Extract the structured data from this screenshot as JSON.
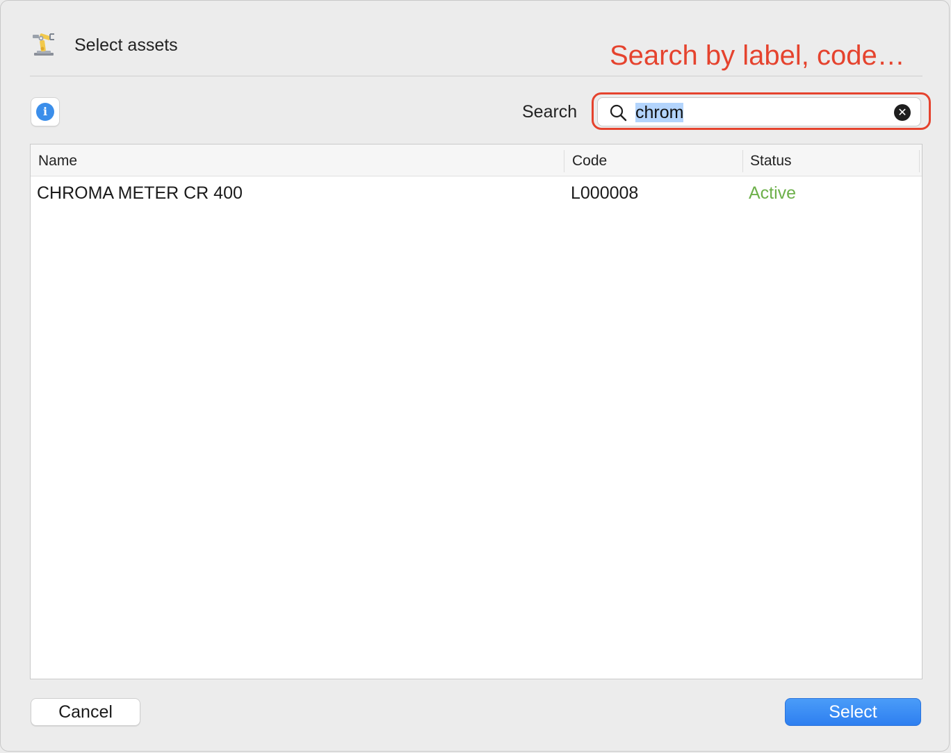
{
  "dialog": {
    "title": "Select assets",
    "app_icon": "robot-arm-icon"
  },
  "annotation": {
    "text": "Search by label, code…",
    "color": "#e5432e"
  },
  "toolbar": {
    "info_icon": "info-icon",
    "search_label": "Search",
    "search_value": "chrom",
    "search_icon": "magnifier-icon",
    "clear_icon": "clear-circle-icon"
  },
  "table": {
    "columns": [
      {
        "label": "Name"
      },
      {
        "label": "Code"
      },
      {
        "label": "Status"
      }
    ],
    "rows": [
      {
        "name": "CHROMA METER CR 400",
        "code": "L000008",
        "status": "Active",
        "status_color": "#6db04a"
      }
    ]
  },
  "footer": {
    "cancel_label": "Cancel",
    "select_label": "Select",
    "accent": "#2e7ff0"
  }
}
